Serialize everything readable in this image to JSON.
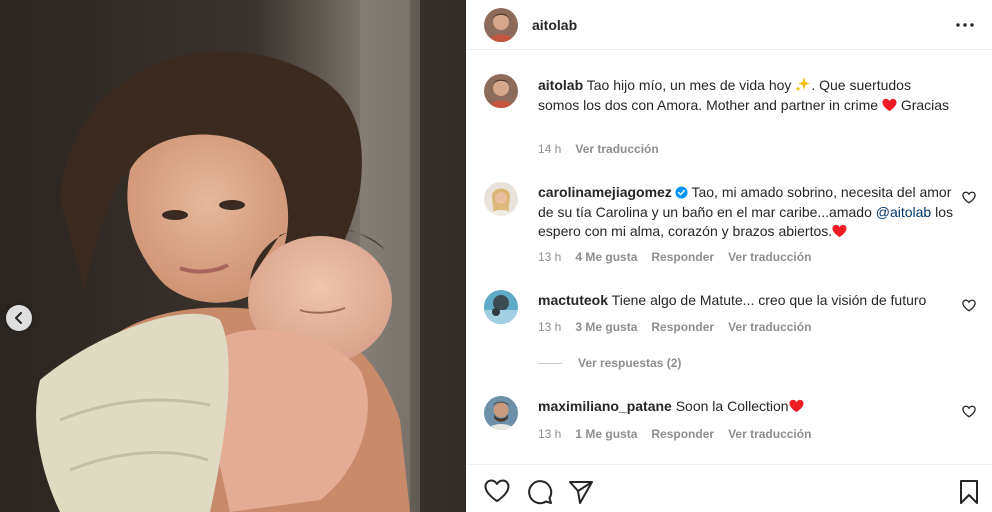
{
  "post": {
    "author": "aitolab"
  },
  "caption": {
    "username": "aitolab",
    "text_1": "Tao hijo mío, un mes de vida hoy ",
    "text_2": ". Que suertudos somos los dos con Amora. Mother and partner in crime ",
    "text_3": " Gracias",
    "time": "14 h",
    "translate": "Ver traducción"
  },
  "comments": [
    {
      "username": "carolinamejiagomez",
      "text_1": "Tao, mi amado sobrino, necesita del amor de su tía Carolina y un baño en el mar caribe...amado ",
      "mention": "@aitolab",
      "text_2": " los espero con mi alma, corazón y brazos abiertos.",
      "time": "13 h",
      "likes": "4 Me gusta",
      "reply": "Responder",
      "translate": "Ver traducción"
    },
    {
      "username": "mactuteok",
      "text_1": "Tiene algo de Matute... creo que la visión de futuro",
      "time": "13 h",
      "likes": "3 Me gusta",
      "reply": "Responder",
      "translate": "Ver traducción",
      "view_replies": "Ver respuestas (2)"
    },
    {
      "username": "maximiliano_patane",
      "text_1": "Soon la Collection",
      "time": "13 h",
      "likes": "1 Me gusta",
      "reply": "Responder",
      "translate": "Ver traducción"
    }
  ],
  "icons": {
    "prev": "chevron-left-icon",
    "more": "more-horizontal-icon",
    "like": "heart-outline-icon",
    "comment": "comment-icon",
    "share": "paper-plane-icon",
    "save": "bookmark-icon",
    "sparkle": "sparkles-icon",
    "heart": "red-heart-icon",
    "verified": "verified-badge-icon"
  },
  "colors": {
    "text": "#262626",
    "secondary": "#8e8e8e",
    "link": "#00376b",
    "verified": "#0095f6",
    "heart": "#ed1c24"
  }
}
